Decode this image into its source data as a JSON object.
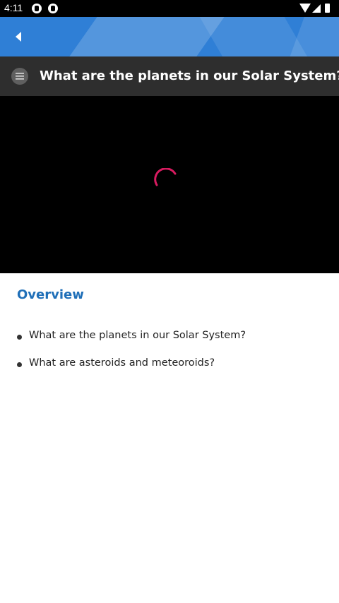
{
  "status_bar": {
    "time": "4:11",
    "notification_icons": [
      "sync-icon",
      "app-notification-icon"
    ],
    "system_icons": [
      "wifi-icon",
      "signal-icon",
      "battery-icon"
    ]
  },
  "app_bar": {
    "color": "#2f7fd6",
    "back_icon": "back-arrow-icon"
  },
  "lesson": {
    "menu_icon": "list-menu-icon",
    "title": "What are the planets in our Solar System?"
  },
  "video": {
    "state": "loading",
    "spinner_color": "#d81b60"
  },
  "overview": {
    "heading": "Overview",
    "heading_color": "#1f6fb8",
    "items": [
      {
        "label": "What are the planets in our Solar System?"
      },
      {
        "label": "What are asteroids and meteoroids?"
      }
    ]
  }
}
